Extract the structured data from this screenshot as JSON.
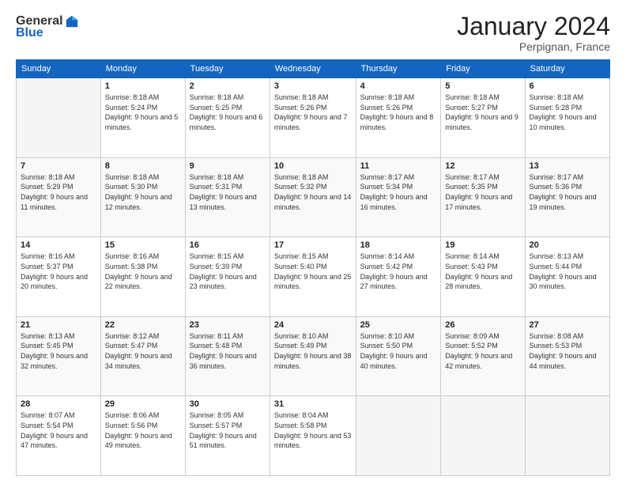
{
  "logo": {
    "general": "General",
    "blue": "Blue"
  },
  "header": {
    "month_title": "January 2024",
    "location": "Perpignan, France"
  },
  "weekdays": [
    "Sunday",
    "Monday",
    "Tuesday",
    "Wednesday",
    "Thursday",
    "Friday",
    "Saturday"
  ],
  "weeks": [
    [
      {
        "num": "",
        "empty": true
      },
      {
        "num": "1",
        "sunrise": "Sunrise: 8:18 AM",
        "sunset": "Sunset: 5:24 PM",
        "daylight": "Daylight: 9 hours and 5 minutes."
      },
      {
        "num": "2",
        "sunrise": "Sunrise: 8:18 AM",
        "sunset": "Sunset: 5:25 PM",
        "daylight": "Daylight: 9 hours and 6 minutes."
      },
      {
        "num": "3",
        "sunrise": "Sunrise: 8:18 AM",
        "sunset": "Sunset: 5:26 PM",
        "daylight": "Daylight: 9 hours and 7 minutes."
      },
      {
        "num": "4",
        "sunrise": "Sunrise: 8:18 AM",
        "sunset": "Sunset: 5:26 PM",
        "daylight": "Daylight: 9 hours and 8 minutes."
      },
      {
        "num": "5",
        "sunrise": "Sunrise: 8:18 AM",
        "sunset": "Sunset: 5:27 PM",
        "daylight": "Daylight: 9 hours and 9 minutes."
      },
      {
        "num": "6",
        "sunrise": "Sunrise: 8:18 AM",
        "sunset": "Sunset: 5:28 PM",
        "daylight": "Daylight: 9 hours and 10 minutes."
      }
    ],
    [
      {
        "num": "7",
        "sunrise": "Sunrise: 8:18 AM",
        "sunset": "Sunset: 5:29 PM",
        "daylight": "Daylight: 9 hours and 11 minutes."
      },
      {
        "num": "8",
        "sunrise": "Sunrise: 8:18 AM",
        "sunset": "Sunset: 5:30 PM",
        "daylight": "Daylight: 9 hours and 12 minutes."
      },
      {
        "num": "9",
        "sunrise": "Sunrise: 8:18 AM",
        "sunset": "Sunset: 5:31 PM",
        "daylight": "Daylight: 9 hours and 13 minutes."
      },
      {
        "num": "10",
        "sunrise": "Sunrise: 8:18 AM",
        "sunset": "Sunset: 5:32 PM",
        "daylight": "Daylight: 9 hours and 14 minutes."
      },
      {
        "num": "11",
        "sunrise": "Sunrise: 8:17 AM",
        "sunset": "Sunset: 5:34 PM",
        "daylight": "Daylight: 9 hours and 16 minutes."
      },
      {
        "num": "12",
        "sunrise": "Sunrise: 8:17 AM",
        "sunset": "Sunset: 5:35 PM",
        "daylight": "Daylight: 9 hours and 17 minutes."
      },
      {
        "num": "13",
        "sunrise": "Sunrise: 8:17 AM",
        "sunset": "Sunset: 5:36 PM",
        "daylight": "Daylight: 9 hours and 19 minutes."
      }
    ],
    [
      {
        "num": "14",
        "sunrise": "Sunrise: 8:16 AM",
        "sunset": "Sunset: 5:37 PM",
        "daylight": "Daylight: 9 hours and 20 minutes."
      },
      {
        "num": "15",
        "sunrise": "Sunrise: 8:16 AM",
        "sunset": "Sunset: 5:38 PM",
        "daylight": "Daylight: 9 hours and 22 minutes."
      },
      {
        "num": "16",
        "sunrise": "Sunrise: 8:15 AM",
        "sunset": "Sunset: 5:39 PM",
        "daylight": "Daylight: 9 hours and 23 minutes."
      },
      {
        "num": "17",
        "sunrise": "Sunrise: 8:15 AM",
        "sunset": "Sunset: 5:40 PM",
        "daylight": "Daylight: 9 hours and 25 minutes."
      },
      {
        "num": "18",
        "sunrise": "Sunrise: 8:14 AM",
        "sunset": "Sunset: 5:42 PM",
        "daylight": "Daylight: 9 hours and 27 minutes."
      },
      {
        "num": "19",
        "sunrise": "Sunrise: 8:14 AM",
        "sunset": "Sunset: 5:43 PM",
        "daylight": "Daylight: 9 hours and 28 minutes."
      },
      {
        "num": "20",
        "sunrise": "Sunrise: 8:13 AM",
        "sunset": "Sunset: 5:44 PM",
        "daylight": "Daylight: 9 hours and 30 minutes."
      }
    ],
    [
      {
        "num": "21",
        "sunrise": "Sunrise: 8:13 AM",
        "sunset": "Sunset: 5:45 PM",
        "daylight": "Daylight: 9 hours and 32 minutes."
      },
      {
        "num": "22",
        "sunrise": "Sunrise: 8:12 AM",
        "sunset": "Sunset: 5:47 PM",
        "daylight": "Daylight: 9 hours and 34 minutes."
      },
      {
        "num": "23",
        "sunrise": "Sunrise: 8:11 AM",
        "sunset": "Sunset: 5:48 PM",
        "daylight": "Daylight: 9 hours and 36 minutes."
      },
      {
        "num": "24",
        "sunrise": "Sunrise: 8:10 AM",
        "sunset": "Sunset: 5:49 PM",
        "daylight": "Daylight: 9 hours and 38 minutes."
      },
      {
        "num": "25",
        "sunrise": "Sunrise: 8:10 AM",
        "sunset": "Sunset: 5:50 PM",
        "daylight": "Daylight: 9 hours and 40 minutes."
      },
      {
        "num": "26",
        "sunrise": "Sunrise: 8:09 AM",
        "sunset": "Sunset: 5:52 PM",
        "daylight": "Daylight: 9 hours and 42 minutes."
      },
      {
        "num": "27",
        "sunrise": "Sunrise: 8:08 AM",
        "sunset": "Sunset: 5:53 PM",
        "daylight": "Daylight: 9 hours and 44 minutes."
      }
    ],
    [
      {
        "num": "28",
        "sunrise": "Sunrise: 8:07 AM",
        "sunset": "Sunset: 5:54 PM",
        "daylight": "Daylight: 9 hours and 47 minutes."
      },
      {
        "num": "29",
        "sunrise": "Sunrise: 8:06 AM",
        "sunset": "Sunset: 5:56 PM",
        "daylight": "Daylight: 9 hours and 49 minutes."
      },
      {
        "num": "30",
        "sunrise": "Sunrise: 8:05 AM",
        "sunset": "Sunset: 5:57 PM",
        "daylight": "Daylight: 9 hours and 51 minutes."
      },
      {
        "num": "31",
        "sunrise": "Sunrise: 8:04 AM",
        "sunset": "Sunset: 5:58 PM",
        "daylight": "Daylight: 9 hours and 53 minutes."
      },
      {
        "num": "",
        "empty": true
      },
      {
        "num": "",
        "empty": true
      },
      {
        "num": "",
        "empty": true
      }
    ]
  ]
}
